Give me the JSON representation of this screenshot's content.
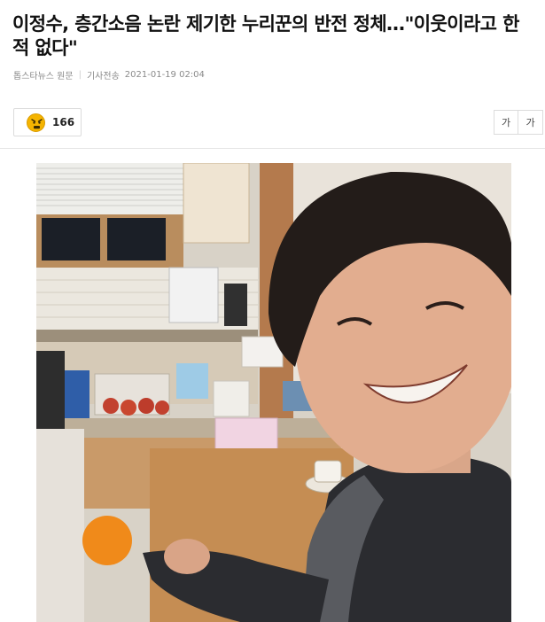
{
  "article": {
    "headline": "이정수, 층간소음 논란 제기한 누리꾼의 반전 정체…\"이웃이라고 한 적 없다\"",
    "source": "톱스타뉴스 원문",
    "meta_label": "기사전송",
    "timestamp": "2021-01-19 02:04"
  },
  "reaction": {
    "icon": "angry-face-icon",
    "count": "166"
  },
  "font_controls": {
    "smaller_label": "가",
    "larger_label": "가"
  },
  "photo": {
    "subject": "article-photo"
  }
}
